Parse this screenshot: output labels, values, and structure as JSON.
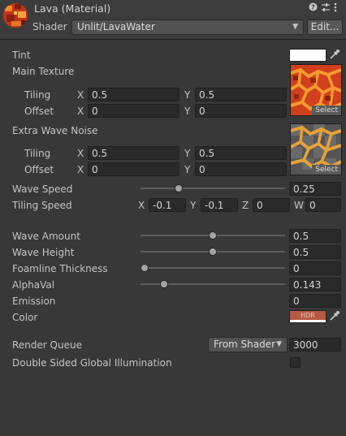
{
  "header": {
    "title": "Lava (Material)",
    "shader_label": "Shader",
    "shader_value": "Unlit/LavaWater",
    "edit_label": "Edit...",
    "icons": [
      "help-icon",
      "preset-sliders-icon",
      "more-options-icon"
    ]
  },
  "tint": {
    "label": "Tint",
    "color": "#ffffff"
  },
  "main_texture": {
    "label": "Main Texture",
    "select_label": "Select",
    "tiling_label": "Tiling",
    "offset_label": "Offset",
    "x_label": "X",
    "y_label": "Y",
    "tiling_x": "0.5",
    "tiling_y": "0.5",
    "offset_x": "0",
    "offset_y": "0"
  },
  "extra_noise": {
    "label": "Extra Wave Noise",
    "select_label": "Select",
    "tiling_label": "Tiling",
    "offset_label": "Offset",
    "x_label": "X",
    "y_label": "Y",
    "tiling_x": "0.5",
    "tiling_y": "0.5",
    "offset_x": "0",
    "offset_y": "0"
  },
  "wave_speed": {
    "label": "Wave Speed",
    "value": "0.25",
    "fraction": 0.25
  },
  "tiling_speed": {
    "label": "Tiling Speed",
    "x_label": "X",
    "y_label": "Y",
    "z_label": "Z",
    "w_label": "W",
    "x": "-0.1",
    "y": "-0.1",
    "z": "0",
    "w": "0"
  },
  "wave_amount": {
    "label": "Wave Amount",
    "value": "0.5",
    "fraction": 0.5
  },
  "wave_height": {
    "label": "Wave Height",
    "value": "0.5",
    "fraction": 0.5
  },
  "foamline": {
    "label": "Foamline Thickness",
    "value": "0",
    "fraction": 0
  },
  "alpha": {
    "label": "AlphaVal",
    "value": "0.143",
    "fraction": 0.143
  },
  "emission": {
    "label": "Emission",
    "value": "0"
  },
  "color": {
    "label": "Color",
    "badge": "HDR",
    "swatch": "#b75a44"
  },
  "render_queue": {
    "label": "Render Queue",
    "mode": "From Shader",
    "value": "3000"
  },
  "double_sided_gi": {
    "label": "Double Sided Global Illumination",
    "checked": false
  }
}
